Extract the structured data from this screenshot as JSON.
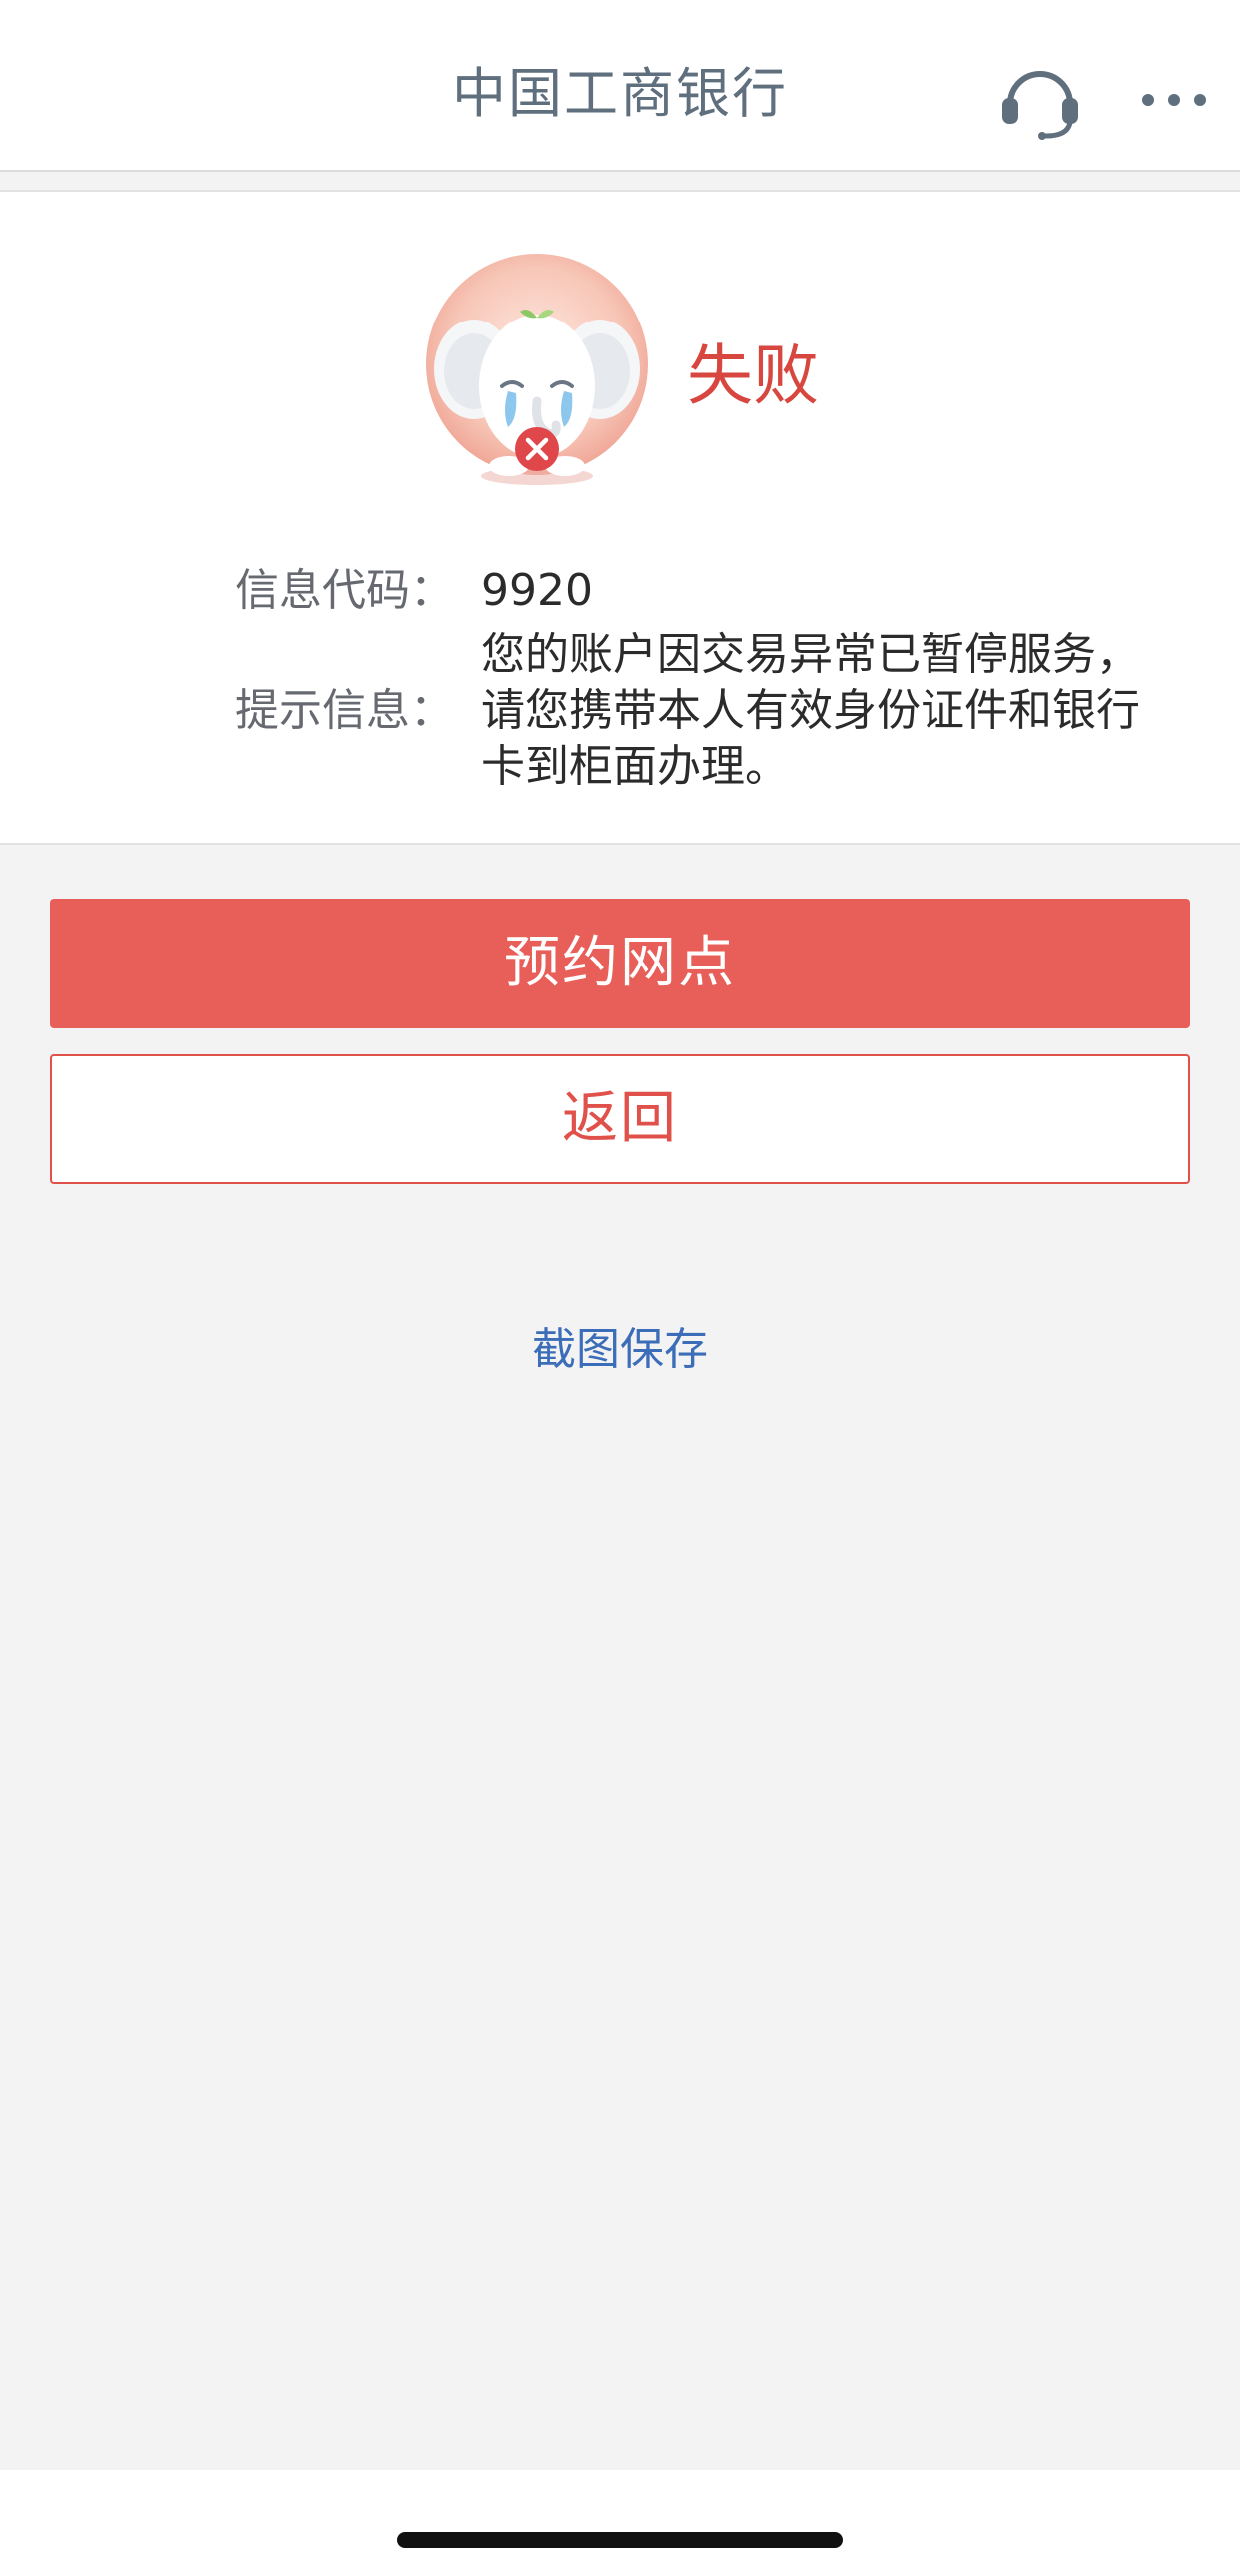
{
  "navbar": {
    "title": "中国工商银行",
    "icons": [
      "headset-icon",
      "more-icon"
    ]
  },
  "result": {
    "status": "失败",
    "status_color": "#d8473f",
    "mascot_icon": "crying-elephant-failure-icon"
  },
  "info": {
    "code_label": "信息代码：",
    "code_value": "9920",
    "message_label": "提示信息：",
    "message_value": "您的账户因交易异常已暂停服务，请您携带本人有效身份证件和银行卡到柜面办理。"
  },
  "actions": {
    "primary_label": "预约网点",
    "secondary_label": "返回",
    "screenshot_link": "截图保存"
  },
  "colors": {
    "accent": "#e85e58",
    "link": "#3b6db8",
    "background": "#f3f3f3"
  }
}
